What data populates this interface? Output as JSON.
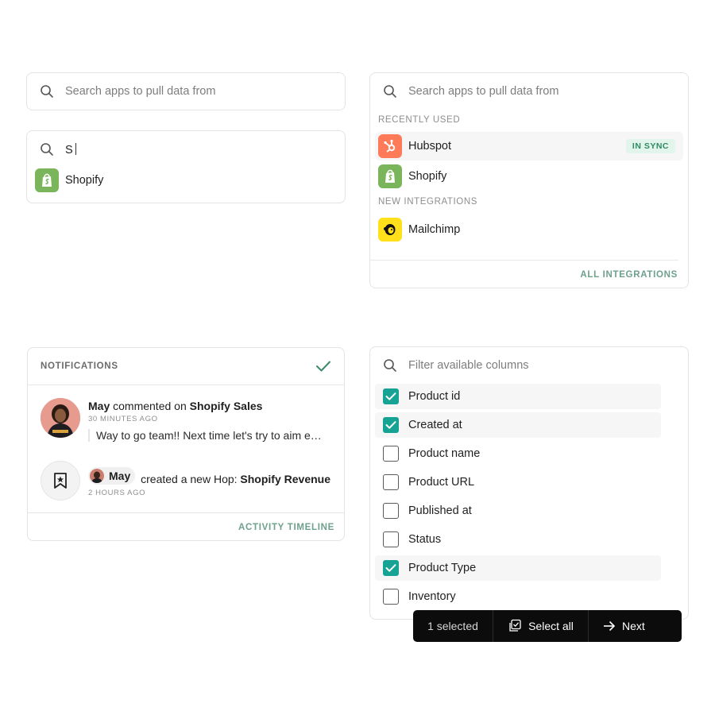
{
  "search_simple": {
    "placeholder": "Search apps to pull data from"
  },
  "search_typed": {
    "query": "S",
    "results": [
      {
        "name": "Shopify",
        "icon": "shopify-icon"
      }
    ]
  },
  "search_dropdown": {
    "placeholder": "Search apps to pull data from",
    "recently_used_label": "RECENTLY USED",
    "recently_used": [
      {
        "name": "Hubspot",
        "icon": "hubspot-icon",
        "badge": "IN SYNC"
      },
      {
        "name": "Shopify",
        "icon": "shopify-icon"
      }
    ],
    "new_label": "NEW INTEGRATIONS",
    "new_integrations": [
      {
        "name": "Mailchimp",
        "icon": "mailchimp-icon"
      }
    ],
    "footer_link": "ALL INTEGRATIONS"
  },
  "notifications": {
    "title": "NOTIFICATIONS",
    "items": [
      {
        "user": "May",
        "action": "commented on",
        "target": "Shopify Sales",
        "time": "30 MINUTES AGO",
        "quote": "Way to go team!! Next time let's try to aim even higher"
      },
      {
        "user": "May",
        "action": "created a new Hop:",
        "target": "Shopify Revenue",
        "time": "2 HOURS AGO"
      }
    ],
    "footer_link": "ACTIVITY TIMELINE"
  },
  "columns": {
    "placeholder": "Filter available columns",
    "items": [
      {
        "label": "Product id",
        "checked": true
      },
      {
        "label": "Created at",
        "checked": true
      },
      {
        "label": "Product name",
        "checked": false
      },
      {
        "label": "Product URL",
        "checked": false
      },
      {
        "label": "Published at",
        "checked": false
      },
      {
        "label": "Status",
        "checked": false
      },
      {
        "label": "Product Type",
        "checked": true
      },
      {
        "label": "Inventory",
        "checked": false
      }
    ]
  },
  "action_bar": {
    "selected_label": "1 selected",
    "select_all_label": "Select all",
    "next_label": "Next"
  },
  "colors": {
    "accent": "#17a393",
    "link": "#6ea08c",
    "badge_bg": "#e2f5ec",
    "badge_text": "#2f8a60",
    "shopify": "#7ab55c",
    "hubspot": "#ff7a59",
    "mailchimp": "#ffe01b"
  }
}
